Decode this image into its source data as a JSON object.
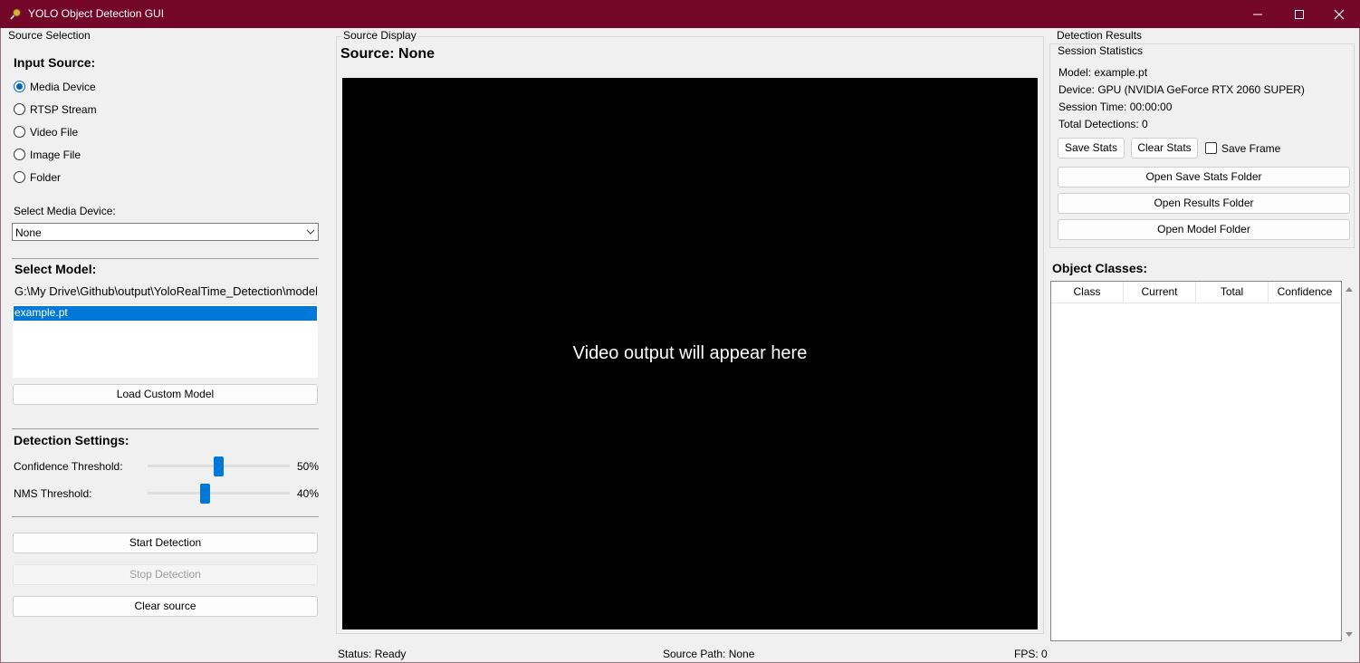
{
  "window": {
    "title": "YOLO Object Detection GUI"
  },
  "source_selection": {
    "group_label": "Source Selection",
    "input_source_heading": "Input Source:",
    "options": [
      "Media Device",
      "RTSP Stream",
      "Video File",
      "Image File",
      "Folder"
    ],
    "selected_option": "Media Device",
    "media_device_label": "Select Media Device:",
    "media_device_value": "None",
    "model_heading": "Select Model:",
    "model_path": "G:\\My Drive\\Github\\output\\YoloRealTime_Detection\\model",
    "model_list": [
      "example.pt"
    ],
    "selected_model": "example.pt",
    "load_custom_model_label": "Load Custom Model",
    "detection_settings_heading": "Detection Settings:",
    "confidence_label": "Confidence Threshold:",
    "confidence_value": "50%",
    "confidence_fraction": 0.5,
    "nms_label": "NMS Threshold:",
    "nms_value": "40%",
    "nms_fraction": 0.4,
    "start_detection_label": "Start Detection",
    "stop_detection_label": "Stop Detection",
    "clear_source_label": "Clear source"
  },
  "source_display": {
    "group_label": "Source Display",
    "source_title": "Source: None",
    "video_placeholder": "Video output will appear here",
    "status": "Status: Ready",
    "source_path": "Source Path: None",
    "fps": "FPS: 0"
  },
  "detection_results": {
    "group_label": "Detection Results",
    "session_stats_label": "Session Statistics",
    "model": "Model: example.pt",
    "device": "Device: GPU (NVIDIA GeForce RTX 2060 SUPER)",
    "session_time": "Session Time: 00:00:00",
    "total_detections": "Total Detections: 0",
    "save_stats_label": "Save Stats",
    "clear_stats_label": "Clear Stats",
    "save_frame_label": "Save Frame",
    "save_frame_checked": false,
    "open_save_stats_folder_label": "Open Save Stats Folder",
    "open_results_folder_label": "Open Results Folder",
    "open_model_folder_label": "Open Model Folder",
    "object_classes_heading": "Object Classes:",
    "columns": [
      "Class",
      "Current",
      "Total",
      "Confidence"
    ],
    "rows": []
  },
  "colors": {
    "titlebar": "#740629",
    "accent": "#0078d7",
    "video_background": "#000000"
  }
}
